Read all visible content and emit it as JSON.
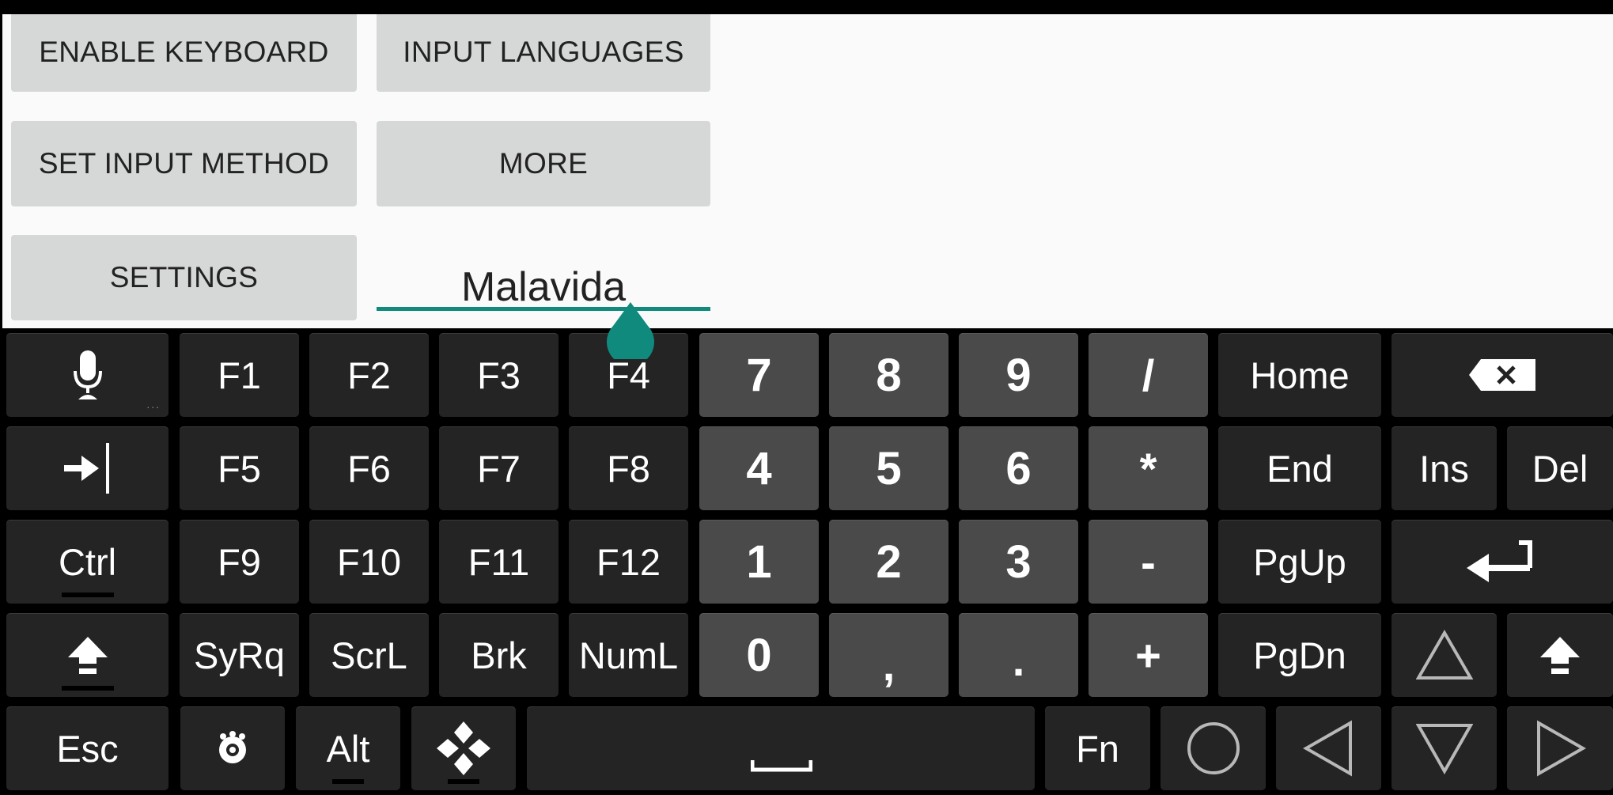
{
  "app": {
    "buttons": [
      {
        "id": "enable-keyboard",
        "label": "ENABLE KEYBOARD"
      },
      {
        "id": "input-languages",
        "label": "INPUT LANGUAGES"
      },
      {
        "id": "set-input-method",
        "label": "SET INPUT METHOD"
      },
      {
        "id": "more",
        "label": "MORE"
      },
      {
        "id": "settings",
        "label": "SETTINGS"
      }
    ],
    "text_field": {
      "value": "Malavida"
    },
    "accent_color": "#0f8a7d"
  },
  "keyboard": {
    "row1": {
      "mic": {
        "icon": "microphone-icon",
        "hint": "..."
      },
      "f1": "F1",
      "f2": "F2",
      "f3": "F3",
      "f4": "F4",
      "n7": "7",
      "n8": "8",
      "n9": "9",
      "slash": "/",
      "home": "Home",
      "backspace": {
        "icon": "backspace-icon"
      }
    },
    "row2": {
      "tab": {
        "icon": "tab-icon"
      },
      "f5": "F5",
      "f6": "F6",
      "f7": "F7",
      "f8": "F8",
      "n4": "4",
      "n5": "5",
      "n6": "6",
      "star": "*",
      "end": "End",
      "ins": "Ins",
      "del": "Del"
    },
    "row3": {
      "ctrl": "Ctrl",
      "f9": "F9",
      "f10": "F10",
      "f11": "F11",
      "f12": "F12",
      "n1": "1",
      "n2": "2",
      "n3": "3",
      "minus": "-",
      "pgup": "PgUp",
      "enter": {
        "icon": "enter-icon"
      }
    },
    "row4": {
      "shift_left": {
        "icon": "shift-icon"
      },
      "syrq": "SyRq",
      "scrl": "ScrL",
      "brk": "Brk",
      "numl": "NumL",
      "n0": "0",
      "comma": ",",
      "period": ".",
      "plus": "+",
      "pgdn": "PgDn",
      "up": {
        "icon": "arrow-up-icon"
      },
      "shift_right": {
        "icon": "shift-icon"
      }
    },
    "row5": {
      "esc": "Esc",
      "settings": {
        "icon": "keyboard-settings-icon"
      },
      "alt": "Alt",
      "dpad": {
        "icon": "dpad-icon"
      },
      "space": {
        "icon": "space-icon"
      },
      "fn": "Fn",
      "home_circle": {
        "icon": "circle-icon"
      },
      "left": {
        "icon": "arrow-left-icon"
      },
      "down": {
        "icon": "arrow-down-icon"
      },
      "right": {
        "icon": "arrow-right-icon"
      }
    },
    "colors": {
      "key": "#242424",
      "numeric_key": "#4a4a4a",
      "icon_outline": "#b8b8b8"
    }
  }
}
